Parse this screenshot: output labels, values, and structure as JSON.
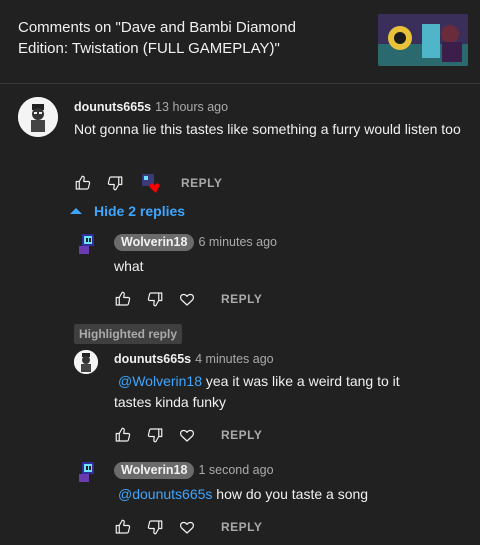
{
  "header": {
    "title": "Comments on \"Dave and Bambi Diamond Edition: Twistation (FULL GAMEPLAY)\""
  },
  "comments": [
    {
      "author": "dounuts665s",
      "time": "13 hours ago",
      "text": "Not gonna lie this tastes like something a furry would listen too",
      "reply_label": "REPLY"
    }
  ],
  "replies_toggle": {
    "label": "Hide 2 replies"
  },
  "replies": [
    {
      "author": "Wolverin18",
      "time": "6 minutes ago",
      "text": "what",
      "reply_label": "REPLY"
    },
    {
      "badge": "Highlighted reply",
      "author": "dounuts665s",
      "time": "4 minutes ago",
      "mention": "@Wolverin18",
      "text": "yea it was like a weird tang to it tastes kinda funky",
      "reply_label": "REPLY"
    },
    {
      "author": "Wolverin18",
      "time": "1 second ago",
      "mention": "@dounuts665s",
      "text": "how do you taste a song",
      "reply_label": "REPLY"
    }
  ],
  "colors": {
    "link": "#3ea6ff",
    "background": "#212121",
    "heart": "#ff0000"
  },
  "icons": [
    "like-icon",
    "dislike-icon",
    "creator-heart-icon",
    "heart-icon",
    "chevron-up-icon"
  ]
}
